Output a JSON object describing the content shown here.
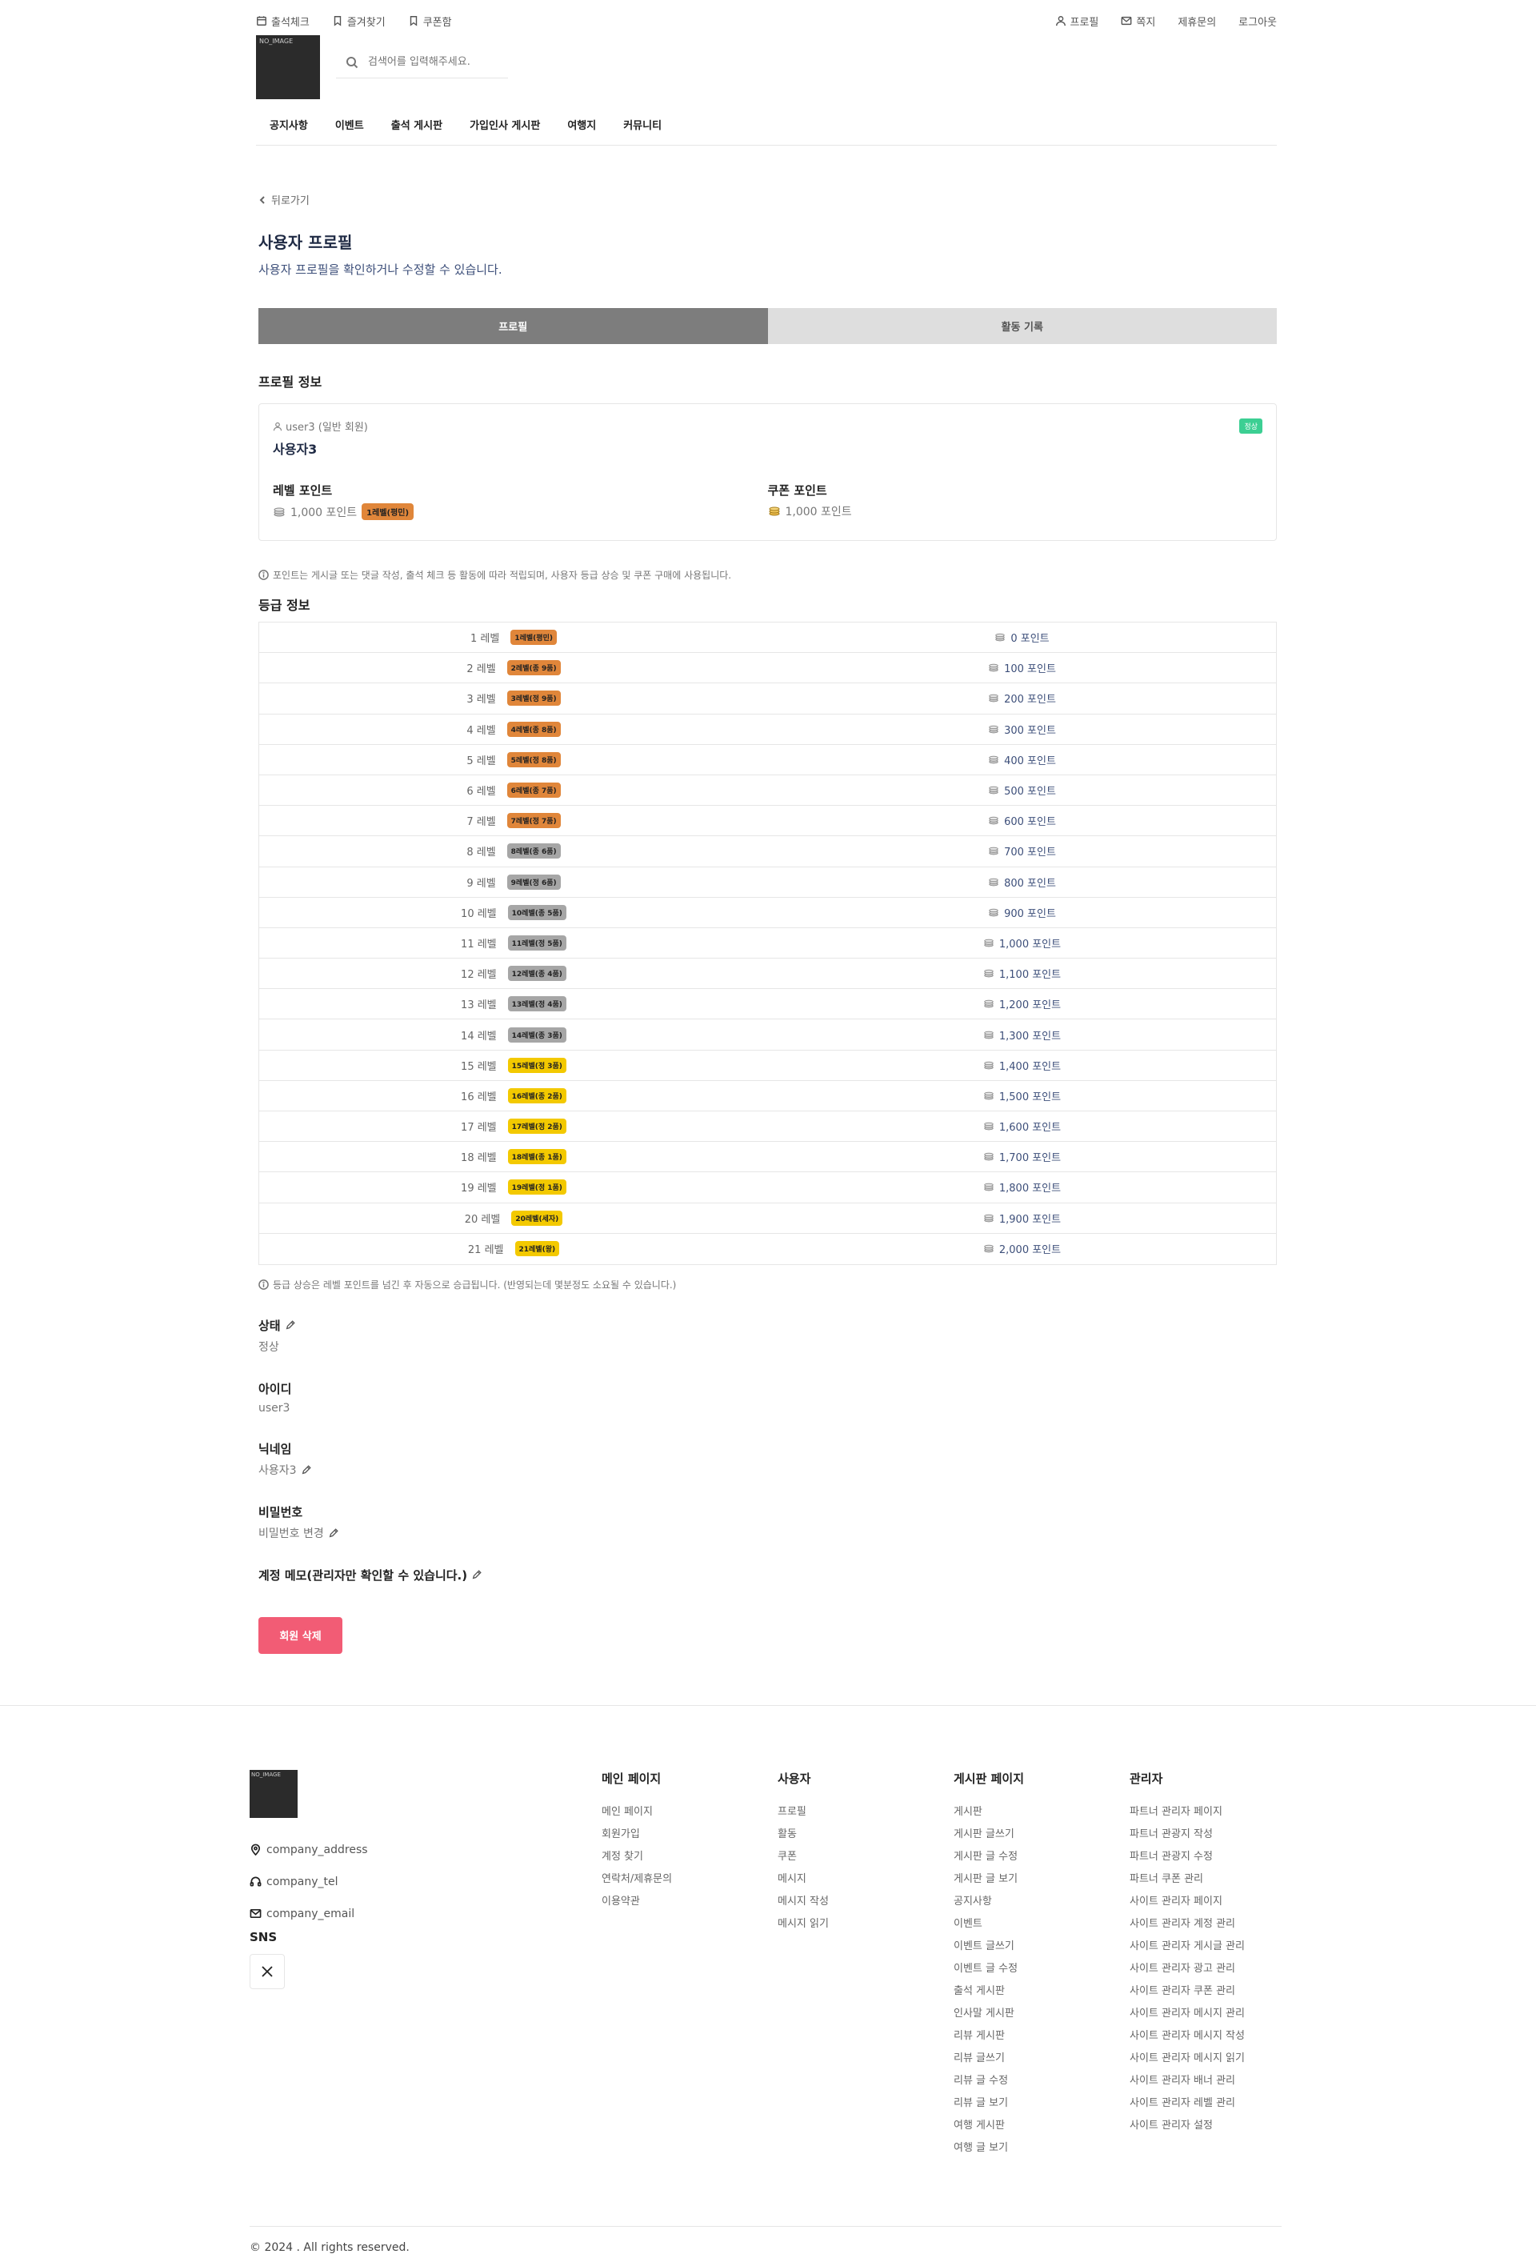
{
  "header": {
    "left_links": [
      {
        "label": "출석체크",
        "icon": "calendar-icon"
      },
      {
        "label": "즐겨찾기",
        "icon": "bookmark-icon"
      },
      {
        "label": "쿠폰함",
        "icon": "coupon-icon"
      }
    ],
    "right_links": [
      {
        "label": "프로필",
        "icon": "user-icon"
      },
      {
        "label": "쪽지",
        "icon": "mail-icon"
      },
      {
        "label": "제휴문의"
      },
      {
        "label": "로그아웃"
      }
    ],
    "logo_text": "NO_IMAGE",
    "search_placeholder": "검색어를 입력해주세요.",
    "nav": [
      "공지사항",
      "이벤트",
      "출석 게시판",
      "가입인사 게시판",
      "여행지",
      "커뮤니티"
    ]
  },
  "page": {
    "back_label": "뒤로가기",
    "title": "사용자 프로필",
    "subtitle": "사용자 프로필을 확인하거나 수정할 수 있습니다.",
    "tabs": [
      "프로필",
      "활동 기록"
    ],
    "profile_section_title": "프로필 정보"
  },
  "profile": {
    "user_id_line": "user3 (일반 회원)",
    "username": "사용자3",
    "status_badge": "정상",
    "level_points_label": "레벨 포인트",
    "level_points_value": "1,000 포인트",
    "level_badge": "1레벨(평민)",
    "coupon_points_label": "쿠폰 포인트",
    "coupon_points_value": "1,000 포인트",
    "points_info": "포인트는 게시글 또는 댓글 작성, 출석 체크 등 활동에 따라 적립되며, 사용자 등급 상승 및 쿠폰 구매에 사용됩니다."
  },
  "grade": {
    "title": "등급 정보",
    "rows": [
      {
        "level": "1 레벨",
        "badge": "1레벨(평민)",
        "points": "0 포인트",
        "color": "orange"
      },
      {
        "level": "2 레벨",
        "badge": "2레벨(종 9품)",
        "points": "100 포인트",
        "color": "orange"
      },
      {
        "level": "3 레벨",
        "badge": "3레벨(정 9품)",
        "points": "200 포인트",
        "color": "orange"
      },
      {
        "level": "4 레벨",
        "badge": "4레벨(종 8품)",
        "points": "300 포인트",
        "color": "orange"
      },
      {
        "level": "5 레벨",
        "badge": "5레벨(정 8품)",
        "points": "400 포인트",
        "color": "orange"
      },
      {
        "level": "6 레벨",
        "badge": "6레벨(종 7품)",
        "points": "500 포인트",
        "color": "orange"
      },
      {
        "level": "7 레벨",
        "badge": "7레벨(정 7품)",
        "points": "600 포인트",
        "color": "orange"
      },
      {
        "level": "8 레벨",
        "badge": "8레벨(종 6품)",
        "points": "700 포인트",
        "color": "gray"
      },
      {
        "level": "9 레벨",
        "badge": "9레벨(정 6품)",
        "points": "800 포인트",
        "color": "gray"
      },
      {
        "level": "10 레벨",
        "badge": "10레벨(종 5품)",
        "points": "900 포인트",
        "color": "gray"
      },
      {
        "level": "11 레벨",
        "badge": "11레벨(정 5품)",
        "points": "1,000 포인트",
        "color": "gray"
      },
      {
        "level": "12 레벨",
        "badge": "12레벨(종 4품)",
        "points": "1,100 포인트",
        "color": "gray"
      },
      {
        "level": "13 레벨",
        "badge": "13레벨(정 4품)",
        "points": "1,200 포인트",
        "color": "gray"
      },
      {
        "level": "14 레벨",
        "badge": "14레벨(종 3품)",
        "points": "1,300 포인트",
        "color": "gray"
      },
      {
        "level": "15 레벨",
        "badge": "15레벨(정 3품)",
        "points": "1,400 포인트",
        "color": "yellow"
      },
      {
        "level": "16 레벨",
        "badge": "16레벨(종 2품)",
        "points": "1,500 포인트",
        "color": "yellow"
      },
      {
        "level": "17 레벨",
        "badge": "17레벨(정 2품)",
        "points": "1,600 포인트",
        "color": "yellow"
      },
      {
        "level": "18 레벨",
        "badge": "18레벨(종 1품)",
        "points": "1,700 포인트",
        "color": "yellow"
      },
      {
        "level": "19 레벨",
        "badge": "19레벨(정 1품)",
        "points": "1,800 포인트",
        "color": "yellow"
      },
      {
        "level": "20 레벨",
        "badge": "20레벨(세자)",
        "points": "1,900 포인트",
        "color": "yellow"
      },
      {
        "level": "21 레벨",
        "badge": "21레벨(왕)",
        "points": "2,000 포인트",
        "color": "yellow"
      }
    ],
    "info": "등급 상승은 레벨 포인트를 넘긴 후 자동으로 승급됩니다. (반영되는데 몇분정도 소요될 수 있습니다.)"
  },
  "fields": {
    "status_label": "상태",
    "status_value": "정상",
    "id_label": "아이디",
    "id_value": "user3",
    "nickname_label": "닉네임",
    "nickname_value": "사용자3",
    "password_label": "비밀번호",
    "password_value": "비밀번호 변경",
    "memo_label": "계정 메모(관리자만 확인할 수 있습니다.)",
    "delete_button": "회원 삭제"
  },
  "colors": {
    "orange_badge": "#e0863a",
    "gray_badge": "#a6a6a6",
    "yellow_badge": "#f3c900",
    "status_green": "#3ccf93",
    "delete_red": "#f25c75"
  },
  "footer": {
    "logo_text": "NO_IMAGE",
    "address": "company_address",
    "tel": "company_tel",
    "email": "company_email",
    "sns_title": "SNS",
    "columns": [
      {
        "title": "메인 페이지",
        "links": [
          "메인 페이지",
          "회원가입",
          "계정 찾기",
          "연락처/제휴문의",
          "이용약관"
        ]
      },
      {
        "title": "사용자",
        "links": [
          "프로필",
          "활동",
          "쿠폰",
          "메시지",
          "메시지 작성",
          "메시지 읽기"
        ]
      },
      {
        "title": "게시판 페이지",
        "links": [
          "게시판",
          "게시판 글쓰기",
          "게시판 글 수정",
          "게시판 글 보기",
          "공지사항",
          "이벤트",
          "이벤트 글쓰기",
          "이벤트 글 수정",
          "출석 게시판",
          "인사말 게시판",
          "리뷰 게시판",
          "리뷰 글쓰기",
          "리뷰 글 수정",
          "리뷰 글 보기",
          "여행 게시판",
          "여행 글 보기"
        ]
      },
      {
        "title": "관리자",
        "links": [
          "파트너 관리자 페이지",
          "파트너 관광지 작성",
          "파트너 관광지 수정",
          "파트너 쿠폰 관리",
          "사이트 관리자 페이지",
          "사이트 관리자 계정 관리",
          "사이트 관리자 게시글 관리",
          "사이트 관리자 광고 관리",
          "사이트 관리자 쿠폰 관리",
          "사이트 관리자 메시지 관리",
          "사이트 관리자 메시지 작성",
          "사이트 관리자 메시지 읽기",
          "사이트 관리자 배너 관리",
          "사이트 관리자 레벨 관리",
          "사이트 관리자 설정"
        ]
      }
    ],
    "copyright": "© 2024 . All rights reserved."
  }
}
